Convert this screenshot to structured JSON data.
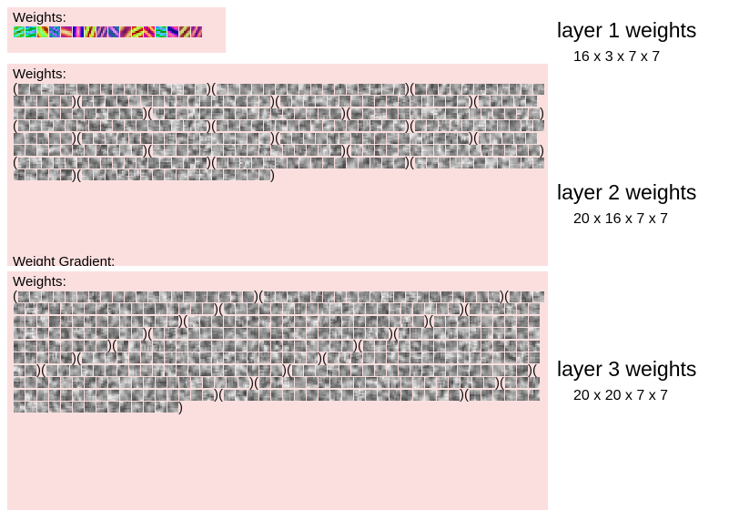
{
  "panels": [
    {
      "id": "layer1",
      "title": "Weights:",
      "grouped": false,
      "groups": 1,
      "tiles_per_group": 16,
      "color_mode": "rgb"
    },
    {
      "id": "layer2",
      "title": "Weights:",
      "clipped_caption": "Weight Gradient:",
      "grouped": true,
      "groups": 20,
      "tiles_per_group": 16,
      "color_mode": "gray"
    },
    {
      "id": "layer3",
      "title": "Weights:",
      "grouped": true,
      "groups": 20,
      "tiles_per_group": 20,
      "color_mode": "gray"
    }
  ],
  "annotations": [
    {
      "title": "layer 1 weights",
      "shape": "16 x 3 x 7 x 7"
    },
    {
      "title": "layer 2 weights",
      "shape": "20 x 16 x 7 x 7"
    },
    {
      "title": "layer 3 weights",
      "shape": "20 x 20 x 7 x 7"
    }
  ],
  "colors": {
    "panel_background": "#fbdfdf",
    "page_background": "#ffffff",
    "text": "#000000"
  },
  "paren_open": "(",
  "paren_close": ")"
}
